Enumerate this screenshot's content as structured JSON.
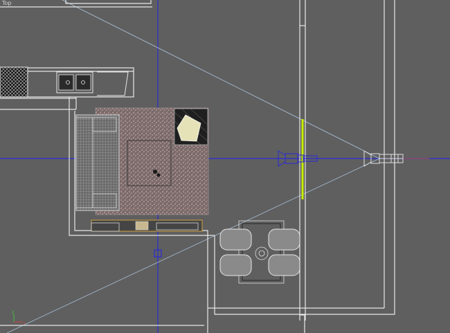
{
  "viewport": {
    "label": "Top",
    "background": "#5f5f5f",
    "colors": {
      "walls": "#e8e8e8",
      "axis": "#2a2ad8",
      "frustum": "#a8c0d8",
      "wireframe": "#cfcfcf",
      "selected": "#c8f000"
    },
    "objects": [
      "kitchen-counter",
      "sofa",
      "rug",
      "coffee-table",
      "armchair",
      "tv-console",
      "dining-table",
      "dining-chairs",
      "window-plane",
      "camera",
      "camera-target"
    ]
  }
}
